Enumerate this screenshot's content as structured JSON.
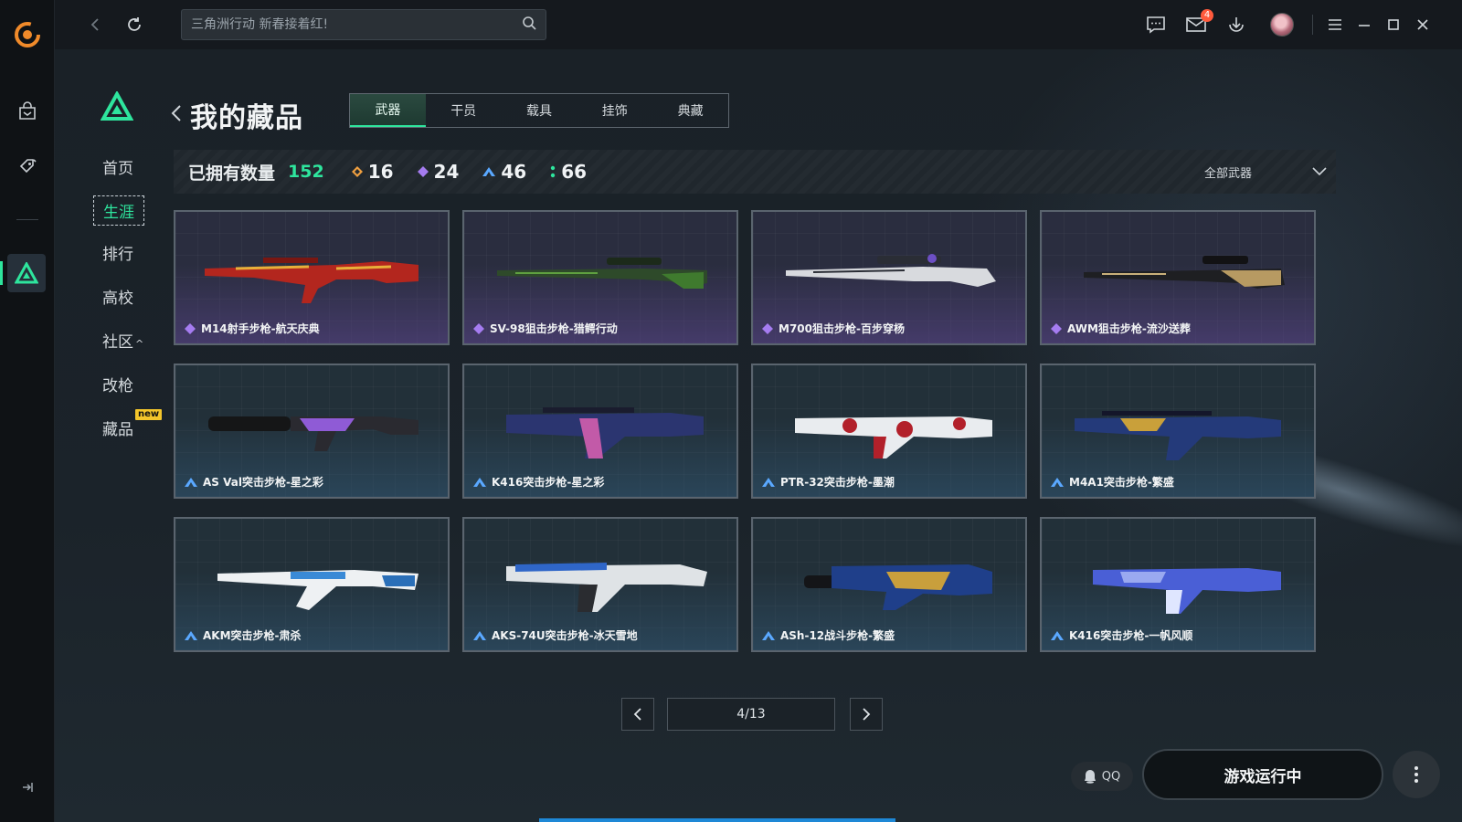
{
  "topbar": {
    "search_placeholder": "三角洲行动 新春接着红!",
    "mail_badge": "4"
  },
  "sidebar": {
    "items": [
      {
        "label": "首页"
      },
      {
        "label": "生涯",
        "active": true
      },
      {
        "label": "排行"
      },
      {
        "label": "高校"
      },
      {
        "label": "社区",
        "caret": "^"
      },
      {
        "label": "改枪"
      },
      {
        "label": "藏品",
        "tag": "new"
      }
    ]
  },
  "page": {
    "title": "我的藏品",
    "tabs": [
      {
        "label": "武器",
        "active": true
      },
      {
        "label": "干员"
      },
      {
        "label": "载具"
      },
      {
        "label": "挂饰"
      },
      {
        "label": "典藏"
      }
    ]
  },
  "stats": {
    "label": "已拥有数量",
    "total": "152",
    "tiers": [
      {
        "value": "16",
        "color": "#f0a040"
      },
      {
        "value": "24",
        "color": "#a57cf0"
      },
      {
        "value": "46",
        "color": "#5aa8ff"
      },
      {
        "value": "66",
        "color": "#2ee59d"
      }
    ],
    "filter": "全部武器"
  },
  "weapons": [
    {
      "name": "M14射手步枪-航天庆典",
      "rarity": "purple"
    },
    {
      "name": "SV-98狙击步枪-猎鳄行动",
      "rarity": "purple"
    },
    {
      "name": "M700狙击步枪-百步穿杨",
      "rarity": "purple"
    },
    {
      "name": "AWM狙击步枪-流沙送葬",
      "rarity": "purple"
    },
    {
      "name": "AS Val突击步枪-星之彩",
      "rarity": "blue"
    },
    {
      "name": "K416突击步枪-星之彩",
      "rarity": "blue"
    },
    {
      "name": "PTR-32突击步枪-墨潮",
      "rarity": "blue"
    },
    {
      "name": "M4A1突击步枪-繁盛",
      "rarity": "blue"
    },
    {
      "name": "AKM突击步枪-肃杀",
      "rarity": "blue"
    },
    {
      "name": "AKS-74U突击步枪-冰天雪地",
      "rarity": "blue"
    },
    {
      "name": "ASh-12战斗步枪-繁盛",
      "rarity": "blue"
    },
    {
      "name": "K416突击步枪-一帆风顺",
      "rarity": "blue"
    }
  ],
  "pager": {
    "label": "4/13"
  },
  "actions": {
    "qq_label": "QQ",
    "run_label": "游戏运行中"
  },
  "colors": {
    "accent": "#2ee59d",
    "purple_rarity": "#a57cf0",
    "blue_rarity": "#5aa8ff"
  }
}
